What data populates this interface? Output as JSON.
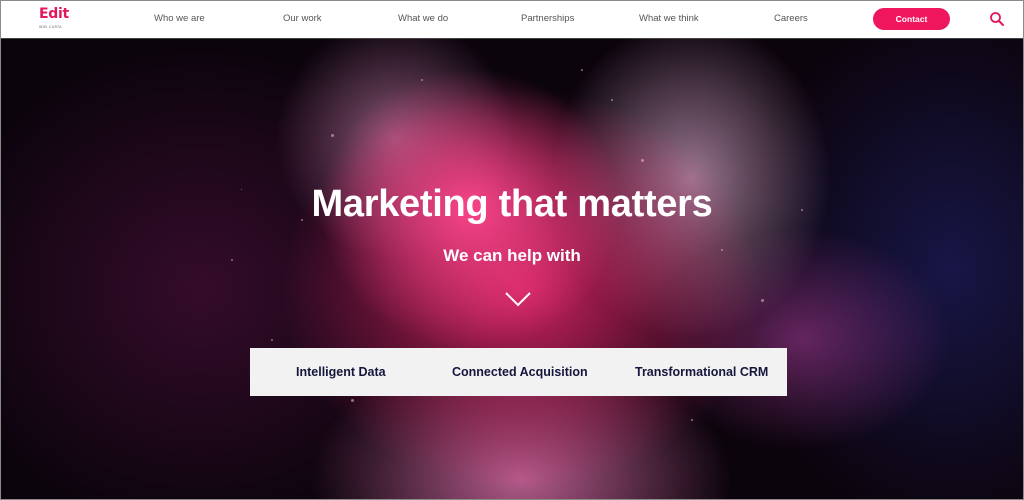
{
  "brand": {
    "logo_text": "Edit",
    "logo_subtext": "WIN CARTA",
    "accent_color": "#f0165e"
  },
  "nav": {
    "items": [
      {
        "label": "Who we are"
      },
      {
        "label": "Our work"
      },
      {
        "label": "What we do"
      },
      {
        "label": "Partnerships"
      },
      {
        "label": "What we think"
      },
      {
        "label": "Careers"
      }
    ],
    "contact_label": "Contact",
    "search_icon": "search-icon"
  },
  "hero": {
    "title": "Marketing that matters",
    "subtitle": "We can help with",
    "scroll_icon": "chevron-down-icon",
    "services": [
      {
        "label": "Intelligent Data"
      },
      {
        "label": "Connected Acquisition"
      },
      {
        "label": "Transformational CRM"
      }
    ]
  }
}
